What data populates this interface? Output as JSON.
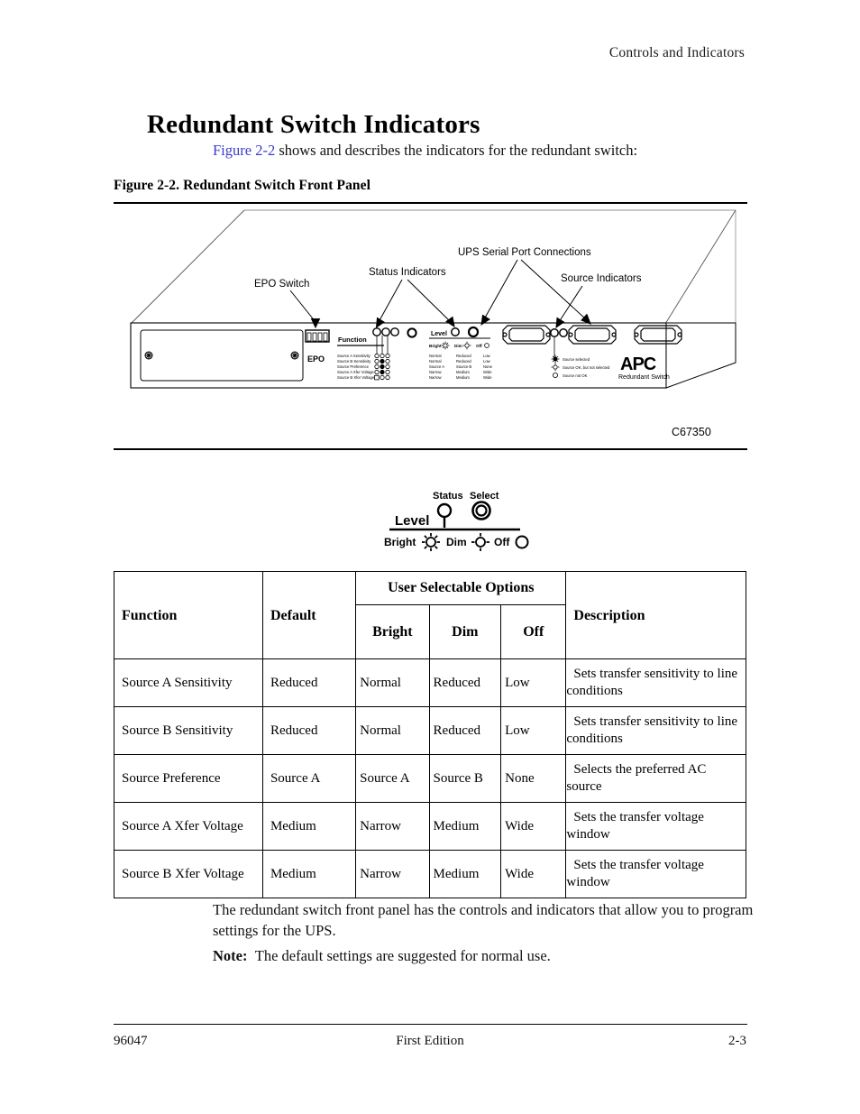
{
  "header": {
    "running_head": "Controls and Indicators"
  },
  "title": "Redundant Switch Indicators",
  "intro": {
    "figure_link": "Figure 2-2",
    "rest": " shows and describes the indicators for the redundant switch:"
  },
  "figure": {
    "caption": "Figure 2-2. Redundant Switch Front Panel",
    "figure_id": "C67350",
    "callouts": {
      "epo_switch": "EPO Switch",
      "status_indicators": "Status Indicators",
      "ups_serial": "UPS Serial Port Connections",
      "source_indicators": "Source Indicators"
    },
    "panel": {
      "epo_label": "EPO",
      "function_label": "Function",
      "level_label": "Level",
      "level_cols": [
        "Bright",
        "Dim",
        "Off"
      ],
      "function_rows": [
        {
          "name": "Source A Sensitivity",
          "bright": "Normal",
          "dim": "Reduced",
          "off": "Low"
        },
        {
          "name": "Source B Sensitivity",
          "bright": "Normal",
          "dim": "Reduced",
          "off": "Low"
        },
        {
          "name": "Source Preference",
          "bright": "Source A",
          "dim": "Source B",
          "off": "None"
        },
        {
          "name": "Source A Xfer Voltage",
          "bright": "Narrow",
          "dim": "Medium",
          "off": "Wide"
        },
        {
          "name": "Source B Xfer Voltage",
          "bright": "Narrow",
          "dim": "Medium",
          "off": "Wide"
        }
      ],
      "source_legend": [
        "Source selected",
        "Source OK, but not selected",
        "Source not OK"
      ],
      "brand": "APC",
      "brand_sub": "Redundant Switch"
    }
  },
  "level_detail": {
    "level_label": "Level",
    "status_label": "Status",
    "select_label": "Select",
    "bright_label": "Bright",
    "dim_label": "Dim",
    "off_label": "Off"
  },
  "table": {
    "group_header": "User Selectable Options",
    "columns": {
      "function": "Function",
      "default": "Default",
      "bright": "Bright",
      "dim": "Dim",
      "off": "Off",
      "description": "Description"
    },
    "rows": [
      {
        "function": "Source A Sensitivity",
        "default": "Reduced",
        "bright": "Normal",
        "dim": "Reduced",
        "off": "Low",
        "description": "Sets transfer sensitivity to line conditions"
      },
      {
        "function": "Source B Sensitivity",
        "default": "Reduced",
        "bright": "Normal",
        "dim": "Reduced",
        "off": "Low",
        "description": "Sets transfer sensitivity to line conditions"
      },
      {
        "function": "Source Preference",
        "default": "Source A",
        "bright": "Source A",
        "dim": "Source B",
        "off": "None",
        "description": "Selects the preferred AC source"
      },
      {
        "function": "Source A Xfer Voltage",
        "default": "Medium",
        "bright": "Narrow",
        "dim": "Medium",
        "off": "Wide",
        "description": "Sets the transfer voltage window"
      },
      {
        "function": "Source B Xfer Voltage",
        "default": "Medium",
        "bright": "Narrow",
        "dim": "Medium",
        "off": "Wide",
        "description": "Sets the transfer voltage window"
      }
    ]
  },
  "body": {
    "paragraph": "The redundant switch front panel has the controls and indicators that allow you to program settings for the UPS.",
    "note_label": "Note:",
    "note_text": "The default settings are suggested for normal use."
  },
  "footer": {
    "left": "96047",
    "center": "First Edition",
    "right": "2-3"
  },
  "colors": {
    "link": "#3b3bcc",
    "text": "#000000",
    "rule": "#000000"
  }
}
